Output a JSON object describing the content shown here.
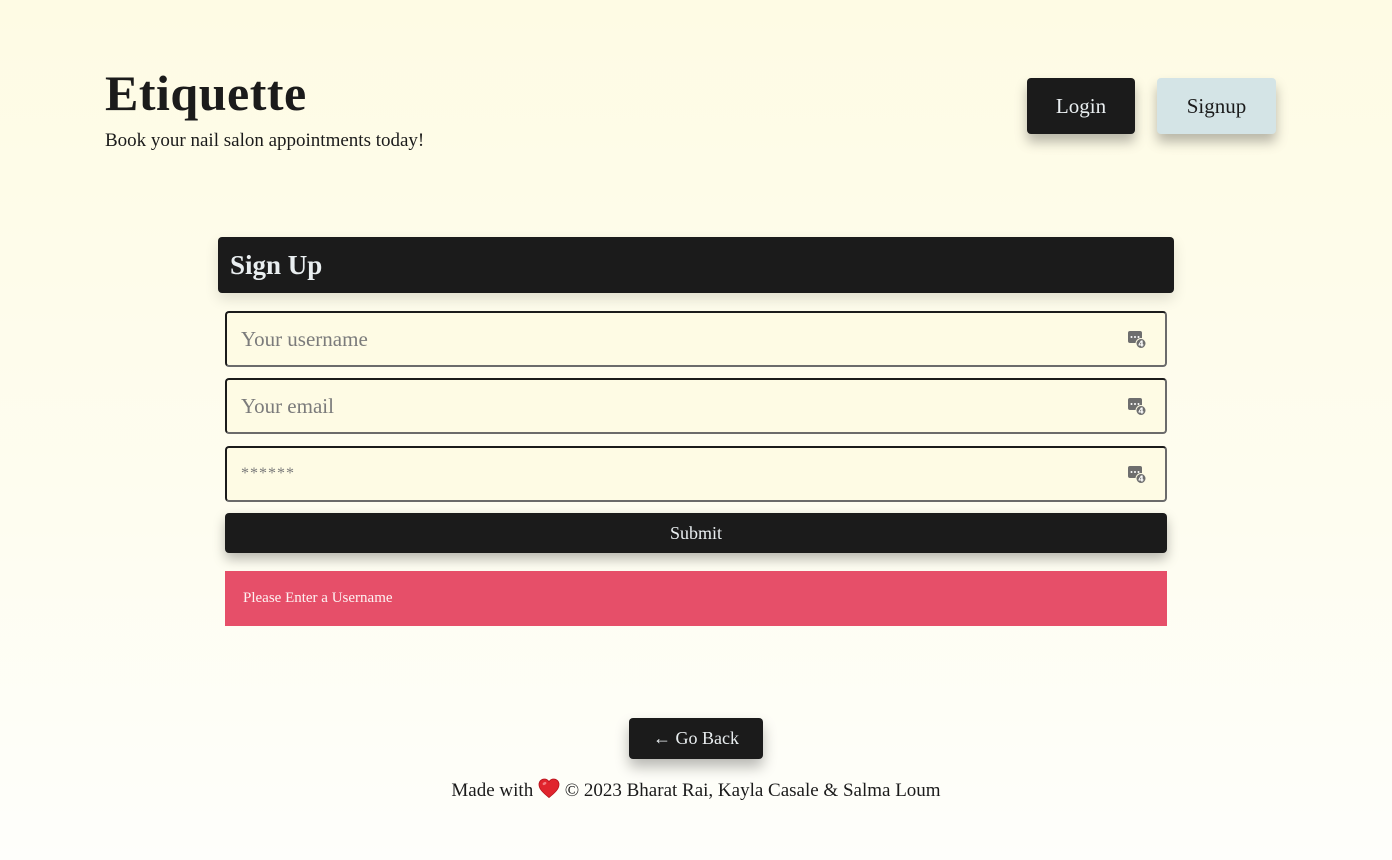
{
  "header": {
    "title": "Etiquette",
    "tagline": "Book your nail salon appointments today!",
    "login_label": "Login",
    "signup_label": "Signup"
  },
  "form": {
    "title": "Sign Up",
    "username_placeholder": "Your username",
    "email_placeholder": "Your email",
    "password_placeholder": "******",
    "submit_label": "Submit",
    "field_icon": "password-manager-keyboard-icon"
  },
  "alert": {
    "message": "Please Enter a Username",
    "color": "#e64f69"
  },
  "go_back_label": "← Go Back",
  "footer": {
    "made_with": "Made with",
    "icon": "heart-icon",
    "credits": "© 2023 Bharat Rai, Kayla Casale & Salma Loum"
  },
  "colors": {
    "background": "#fefbe4",
    "dark": "#1b1b1b",
    "signup_button": "#d4e4e6"
  }
}
